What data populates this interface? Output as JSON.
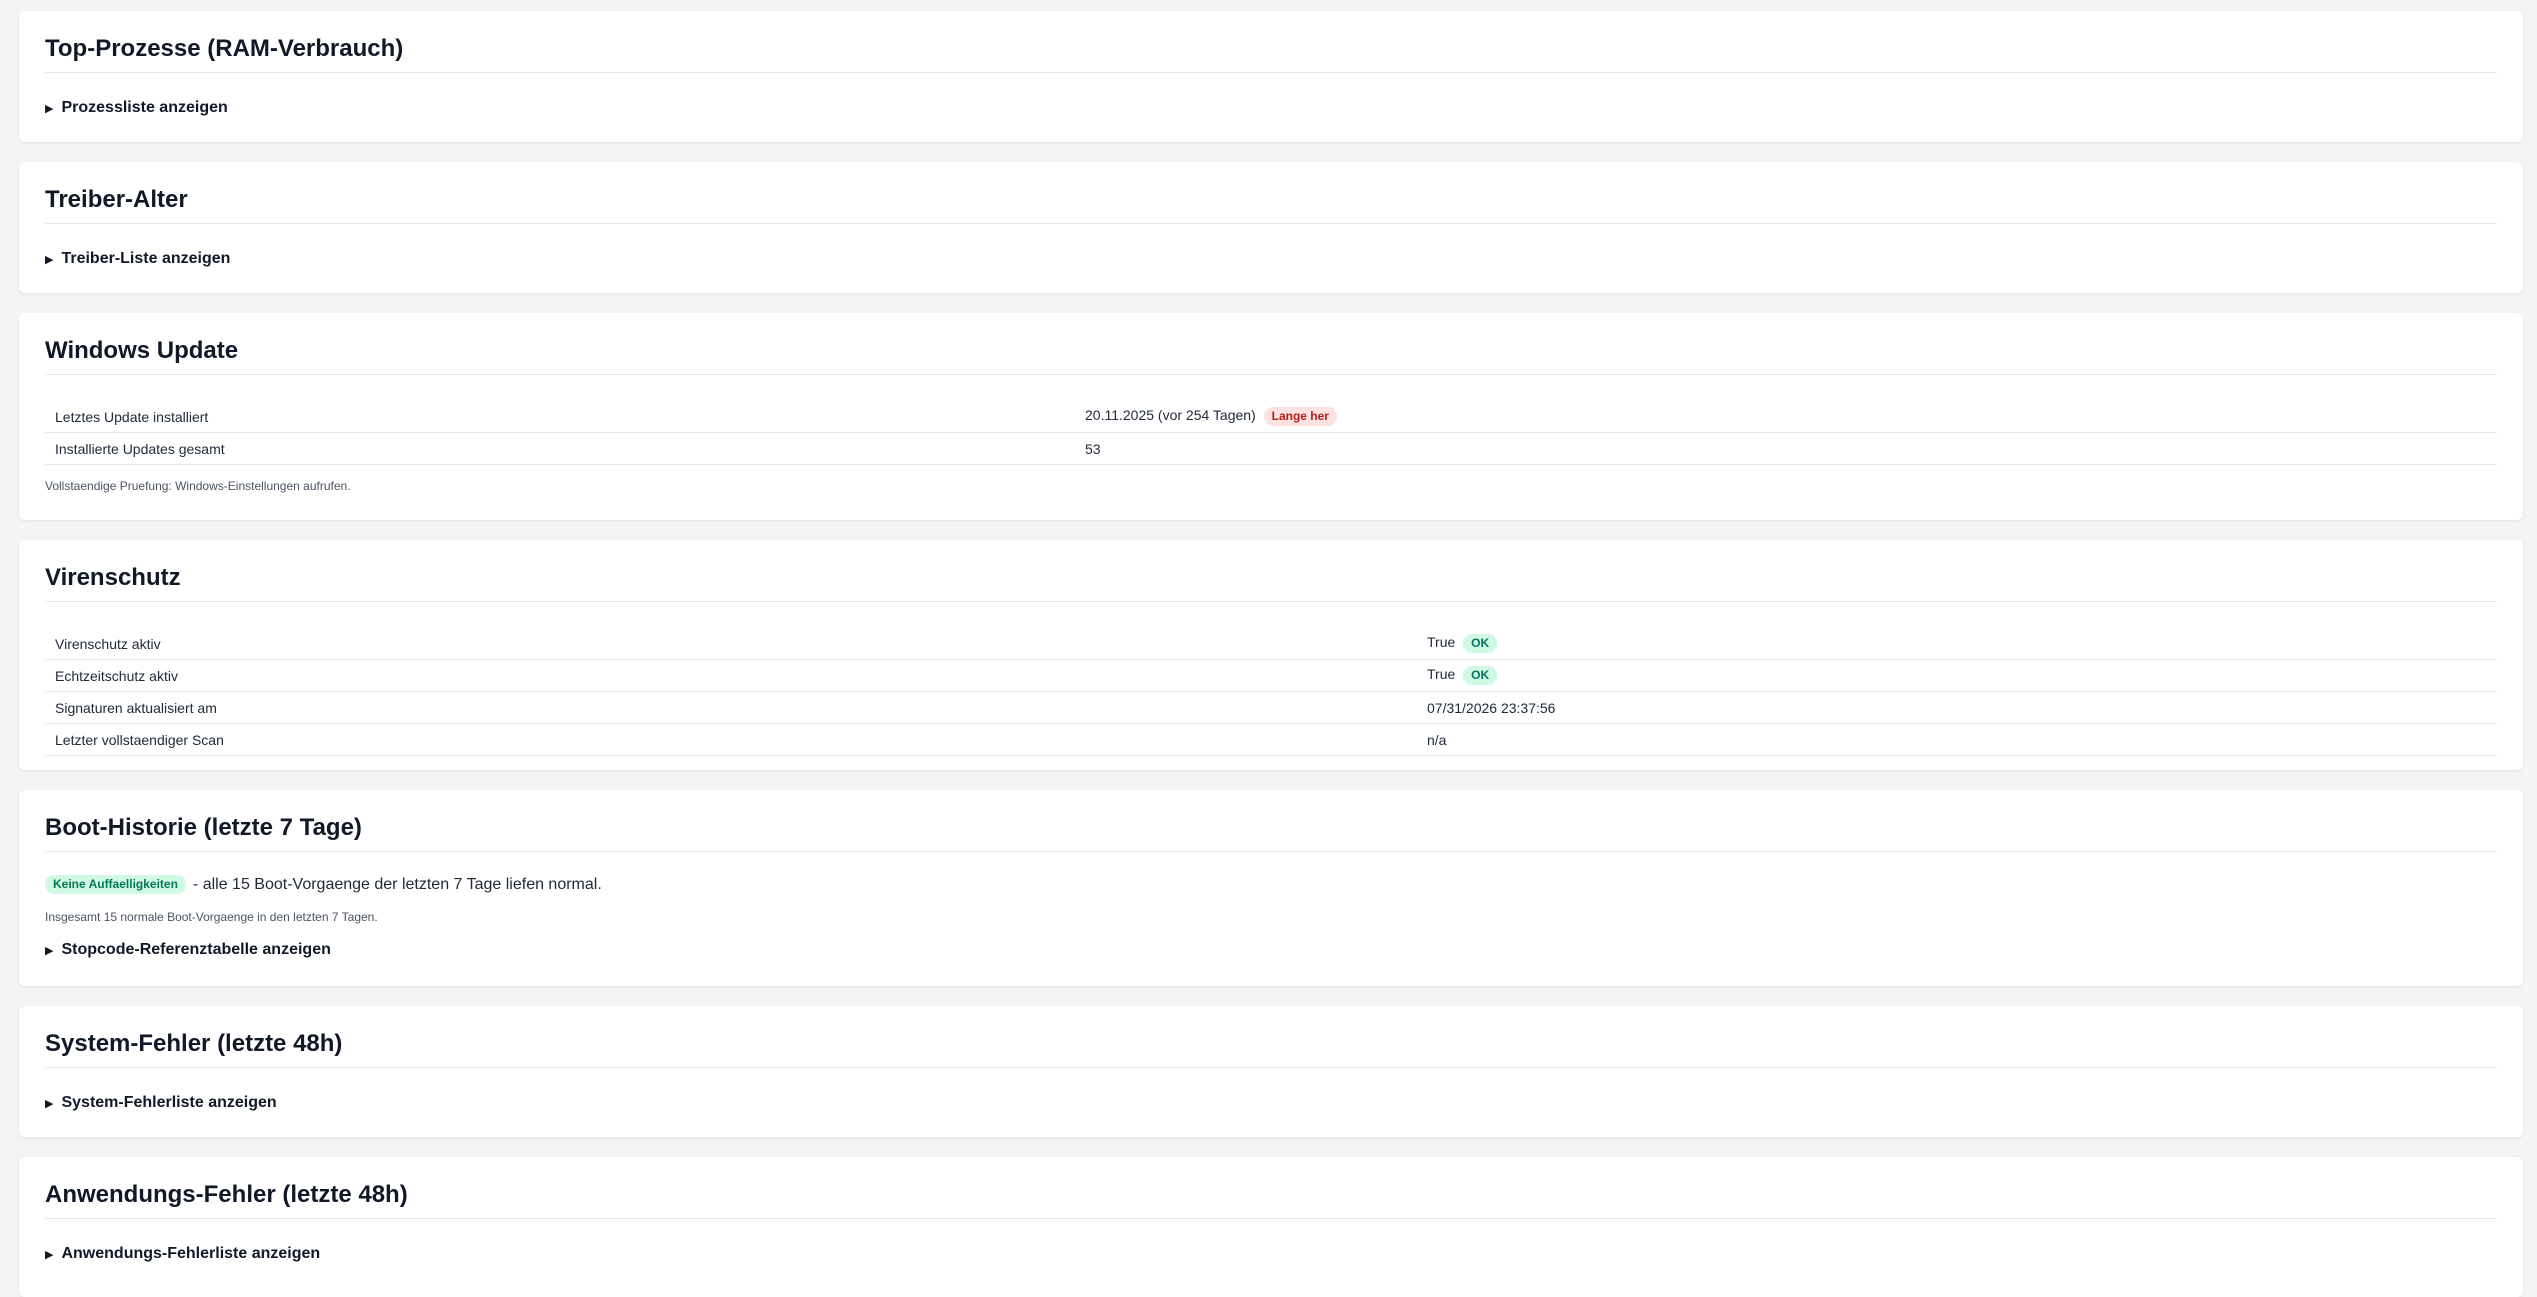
{
  "sections": {
    "processes": {
      "title": "Top-Prozesse (RAM-Verbrauch)",
      "toggle": "Prozessliste anzeigen"
    },
    "drivers": {
      "title": "Treiber-Alter",
      "toggle": "Treiber-Liste anzeigen"
    },
    "windows_update": {
      "title": "Windows Update",
      "rows": [
        {
          "label": "Letztes Update installiert",
          "value": "20.11.2025 (vor 254 Tagen)",
          "badge": "Lange her"
        },
        {
          "label": "Installierte Updates gesamt",
          "value": "53"
        }
      ],
      "note": "Vollstaendige Pruefung: Windows-Einstellungen aufrufen."
    },
    "antivirus": {
      "title": "Virenschutz",
      "rows": [
        {
          "label": "Virenschutz aktiv",
          "value": "True",
          "badge": "OK"
        },
        {
          "label": "Echtzeitschutz aktiv",
          "value": "True",
          "badge": "OK"
        },
        {
          "label": "Signaturen aktualisiert am",
          "value": "07/31/2026 23:37:56"
        },
        {
          "label": "Letzter vollstaendiger Scan",
          "value": "n/a"
        }
      ]
    },
    "boot": {
      "title": "Boot-Historie (letzte 7 Tage)",
      "badge": "Keine Auffaelligkeiten",
      "summary": "- alle 15 Boot-Vorgaenge der letzten 7 Tage liefen normal.",
      "note": "Insgesamt 15 normale Boot-Vorgaenge in den letzten 7 Tagen.",
      "toggle": "Stopcode-Referenztabelle anzeigen"
    },
    "system_errors": {
      "title": "System-Fehler (letzte 48h)",
      "toggle": "System-Fehlerliste anzeigen"
    },
    "app_errors": {
      "title": "Anwendungs-Fehler (letzte 48h)",
      "toggle": "Anwendungs-Fehlerliste anzeigen"
    }
  },
  "icons": {
    "toggle": "triangle-right-icon"
  },
  "colors": {
    "badge_red_bg": "#fde2e2",
    "badge_red_fg": "#b91c1c",
    "badge_green_bg": "#d1fae5",
    "badge_green_fg": "#047857"
  }
}
